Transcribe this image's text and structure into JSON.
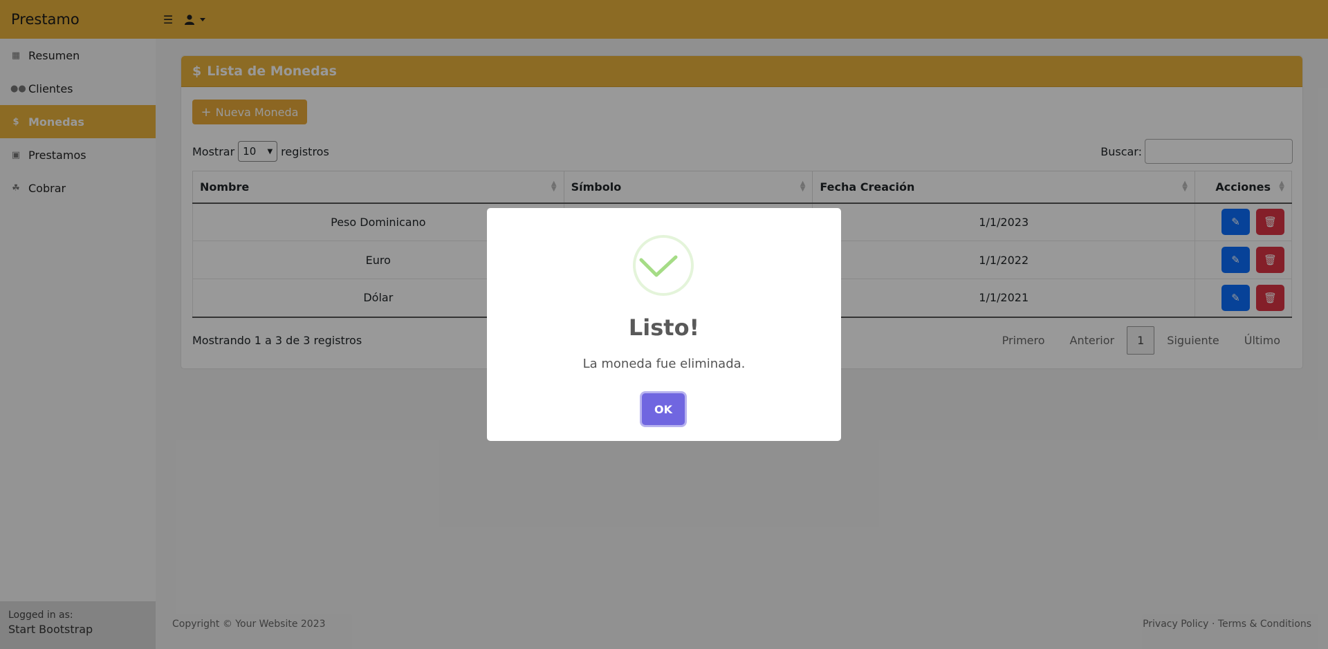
{
  "app": {
    "brand": "Prestamo"
  },
  "sidebar": {
    "items": [
      {
        "label": "Resumen",
        "icon": "table-icon"
      },
      {
        "label": "Clientes",
        "icon": "users-icon"
      },
      {
        "label": "Monedas",
        "icon": "dollar-icon",
        "active": true
      },
      {
        "label": "Prestamos",
        "icon": "money-bill-icon"
      },
      {
        "label": "Cobrar",
        "icon": "hand-holding-icon"
      }
    ],
    "footer": {
      "logged_label": "Logged in as:",
      "user": "Start Bootstrap"
    }
  },
  "card": {
    "title": "Lista de Monedas",
    "new_button": "Nueva Moneda",
    "show_prefix": "Mostrar",
    "show_value": "10",
    "show_suffix": "registros",
    "search_label": "Buscar:",
    "search_value": ""
  },
  "table": {
    "headers": [
      "Nombre",
      "Símbolo",
      "Fecha Creación",
      "Acciones"
    ],
    "rows": [
      {
        "nombre": "Peso Dominicano",
        "simbolo": "",
        "fecha": "1/1/2023"
      },
      {
        "nombre": "Euro",
        "simbolo": "",
        "fecha": "1/1/2022"
      },
      {
        "nombre": "Dólar",
        "simbolo": "",
        "fecha": "1/1/2021"
      }
    ]
  },
  "info": "Mostrando 1 a 3 de 3 registros",
  "pager": {
    "first": "Primero",
    "prev": "Anterior",
    "current": "1",
    "next": "Siguiente",
    "last": "Último"
  },
  "footer": {
    "copyright": "Copyright © Your Website 2023",
    "privacy": "Privacy Policy",
    "separator": "·",
    "terms": "Terms & Conditions"
  },
  "modal": {
    "title": "Listo!",
    "text": "La moneda fue eliminada.",
    "ok": "OK"
  },
  "colors": {
    "accent": "#eab23d",
    "edit": "#0d6efd",
    "delete": "#dc3545",
    "ok": "#7066e0",
    "success": "#a5dc86"
  }
}
